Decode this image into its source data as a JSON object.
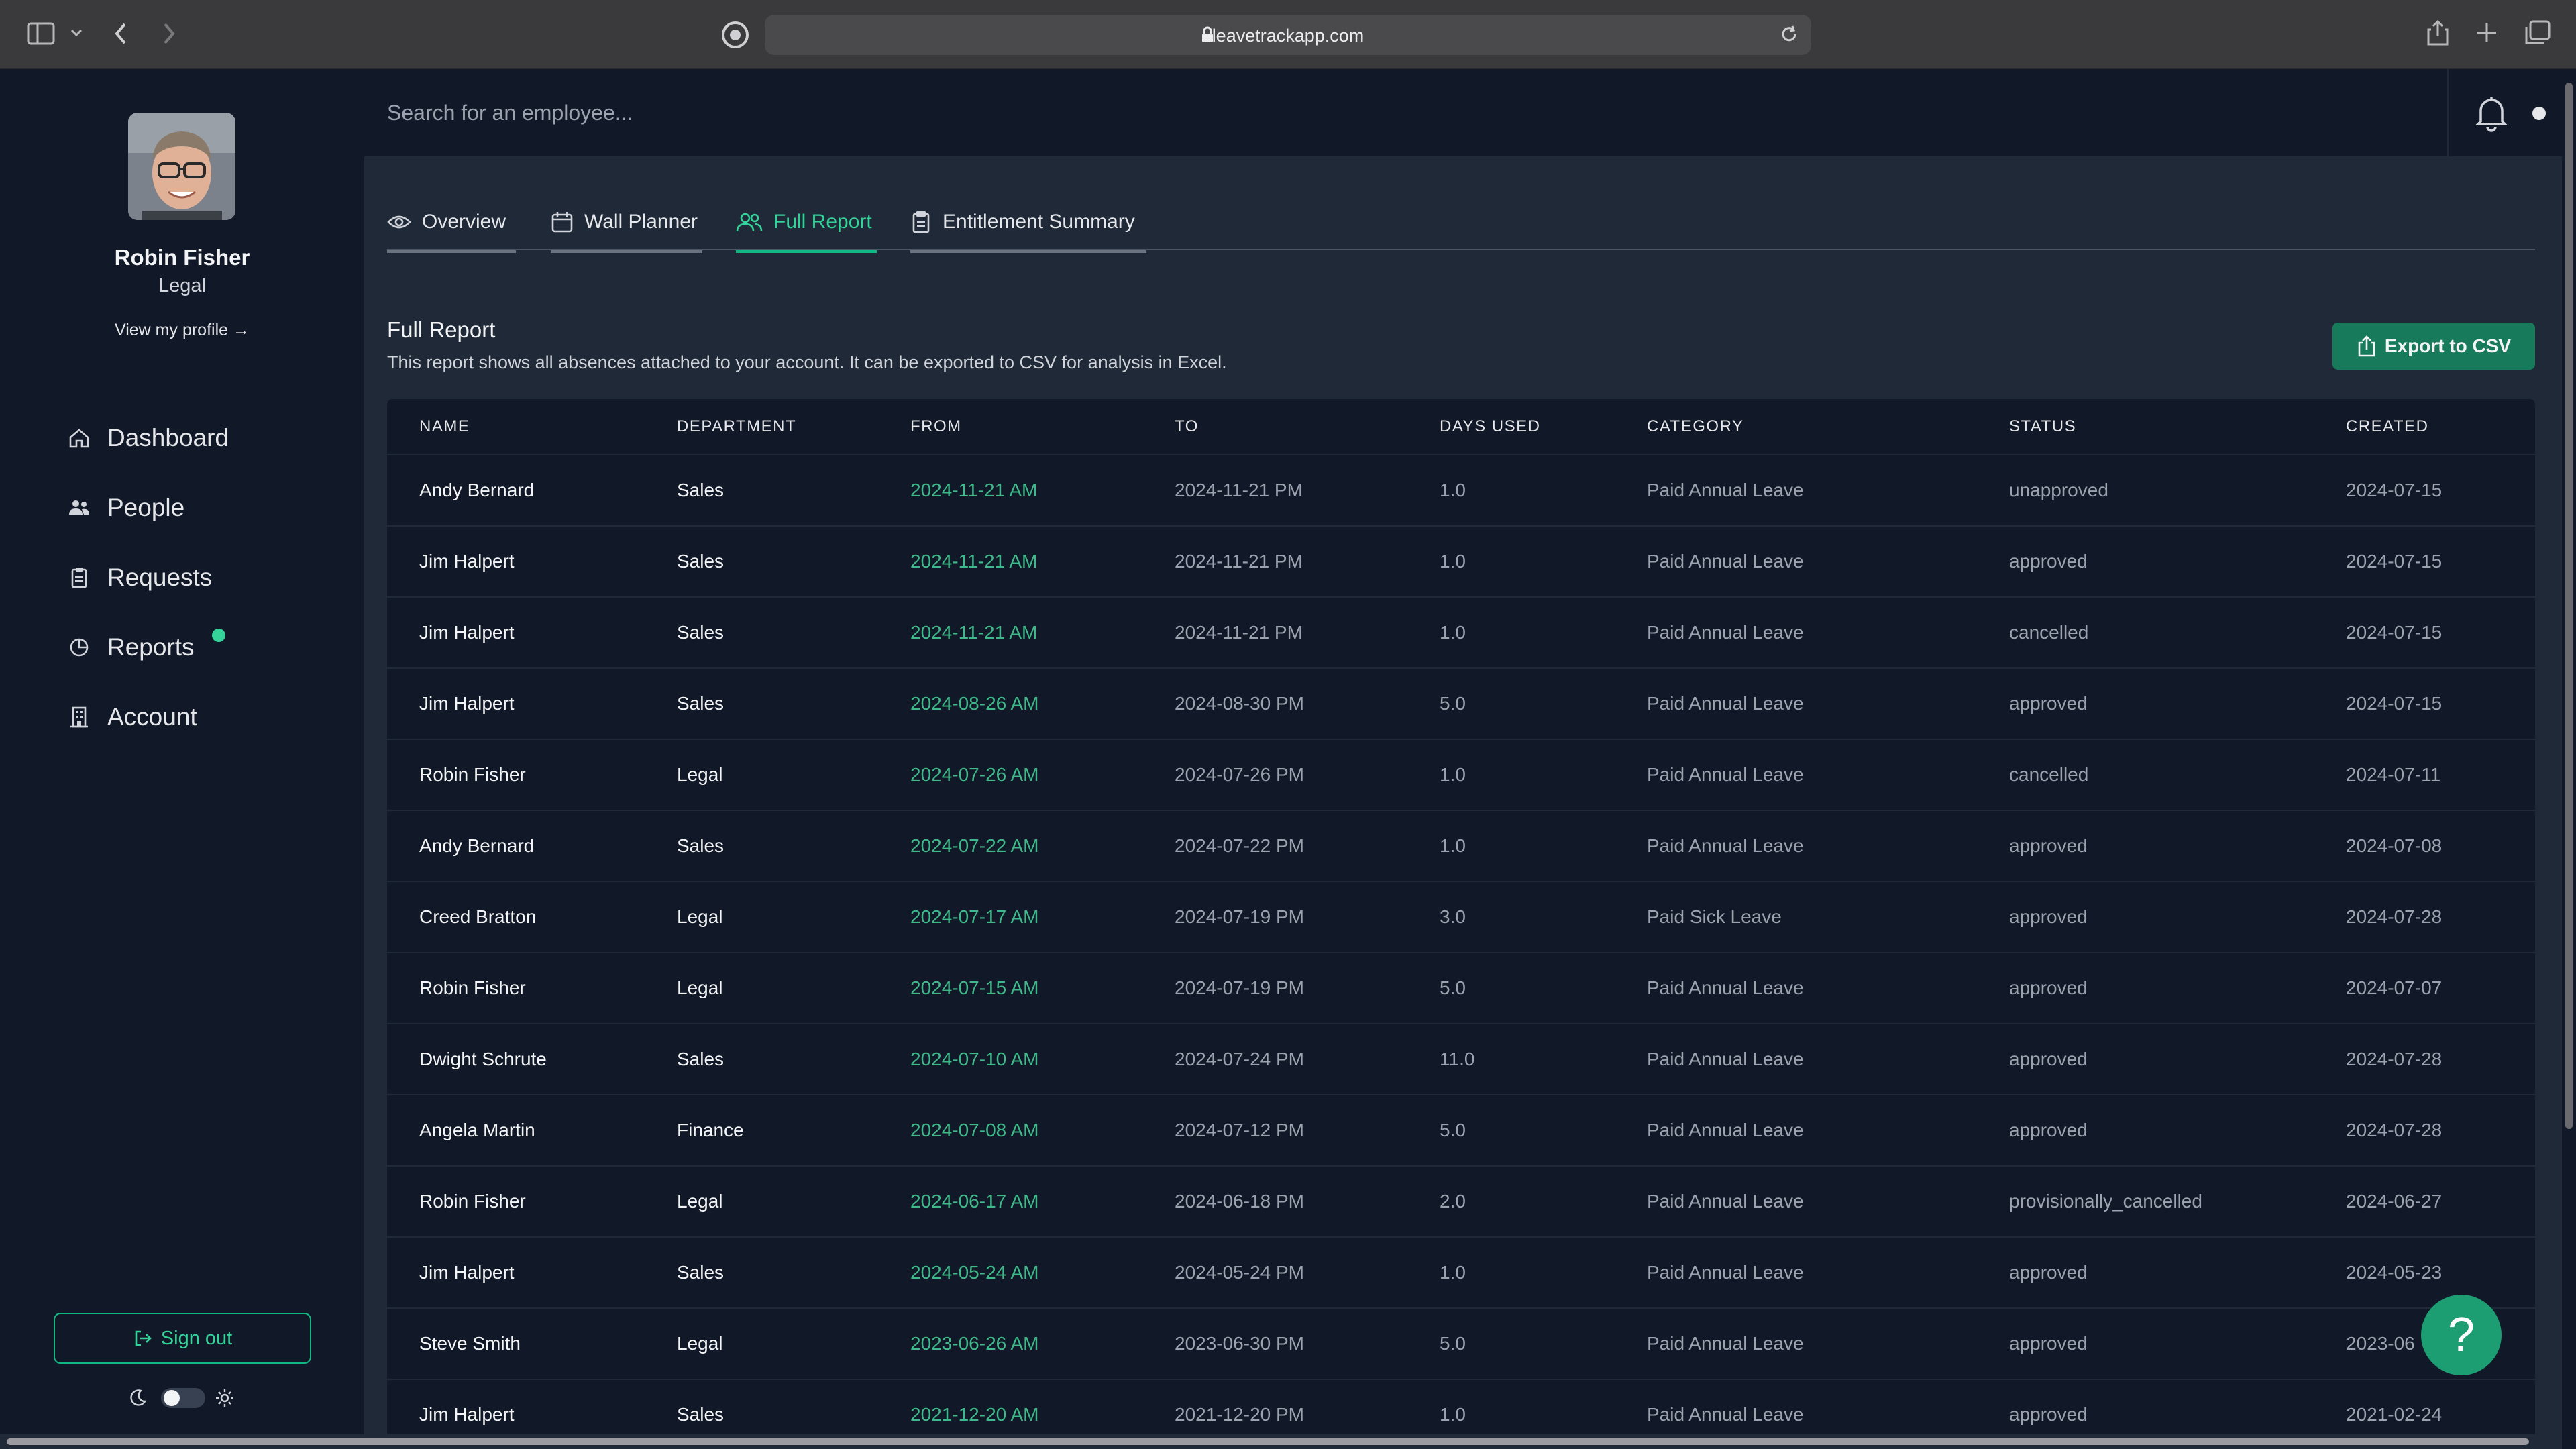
{
  "browser": {
    "url": "leavetrackapp.com"
  },
  "sidebar": {
    "user_name": "Robin Fisher",
    "user_dept": "Legal",
    "profile_link": "View my profile →",
    "nav": [
      {
        "label": "Dashboard",
        "icon": "home-icon"
      },
      {
        "label": "People",
        "icon": "people-icon"
      },
      {
        "label": "Requests",
        "icon": "clipboard-icon"
      },
      {
        "label": "Reports",
        "icon": "pie-chart-icon"
      },
      {
        "label": "Account",
        "icon": "building-icon"
      }
    ],
    "sign_out": "Sign out"
  },
  "search": {
    "placeholder": "Search for an employee..."
  },
  "tabs": [
    {
      "label": "Overview",
      "icon": "eye-icon"
    },
    {
      "label": "Wall Planner",
      "icon": "calendar-icon"
    },
    {
      "label": "Full Report",
      "icon": "users-icon",
      "active": true
    },
    {
      "label": "Entitlement Summary",
      "icon": "clipboard-icon"
    }
  ],
  "report": {
    "title": "Full Report",
    "description": "This report shows all absences attached to your account. It can be exported to CSV for analysis in Excel.",
    "export_label": "Export to CSV",
    "columns": [
      "NAME",
      "DEPARTMENT",
      "FROM",
      "TO",
      "DAYS USED",
      "CATEGORY",
      "STATUS",
      "CREATED"
    ],
    "rows": [
      [
        "Andy Bernard",
        "Sales",
        "2024-11-21 AM",
        "2024-11-21 PM",
        "1.0",
        "Paid Annual Leave",
        "unapproved",
        "2024-07-15"
      ],
      [
        "Jim Halpert",
        "Sales",
        "2024-11-21 AM",
        "2024-11-21 PM",
        "1.0",
        "Paid Annual Leave",
        "approved",
        "2024-07-15"
      ],
      [
        "Jim Halpert",
        "Sales",
        "2024-11-21 AM",
        "2024-11-21 PM",
        "1.0",
        "Paid Annual Leave",
        "cancelled",
        "2024-07-15"
      ],
      [
        "Jim Halpert",
        "Sales",
        "2024-08-26 AM",
        "2024-08-30 PM",
        "5.0",
        "Paid Annual Leave",
        "approved",
        "2024-07-15"
      ],
      [
        "Robin Fisher",
        "Legal",
        "2024-07-26 AM",
        "2024-07-26 PM",
        "1.0",
        "Paid Annual Leave",
        "cancelled",
        "2024-07-11"
      ],
      [
        "Andy Bernard",
        "Sales",
        "2024-07-22 AM",
        "2024-07-22 PM",
        "1.0",
        "Paid Annual Leave",
        "approved",
        "2024-07-08"
      ],
      [
        "Creed Bratton",
        "Legal",
        "2024-07-17 AM",
        "2024-07-19 PM",
        "3.0",
        "Paid Sick Leave",
        "approved",
        "2024-07-28"
      ],
      [
        "Robin Fisher",
        "Legal",
        "2024-07-15 AM",
        "2024-07-19 PM",
        "5.0",
        "Paid Annual Leave",
        "approved",
        "2024-07-07"
      ],
      [
        "Dwight Schrute",
        "Sales",
        "2024-07-10 AM",
        "2024-07-24 PM",
        "11.0",
        "Paid Annual Leave",
        "approved",
        "2024-07-28"
      ],
      [
        "Angela Martin",
        "Finance",
        "2024-07-08 AM",
        "2024-07-12 PM",
        "5.0",
        "Paid Annual Leave",
        "approved",
        "2024-07-28"
      ],
      [
        "Robin Fisher",
        "Legal",
        "2024-06-17 AM",
        "2024-06-18 PM",
        "2.0",
        "Paid Annual Leave",
        "provisionally_cancelled",
        "2024-06-27"
      ],
      [
        "Jim Halpert",
        "Sales",
        "2024-05-24 AM",
        "2024-05-24 PM",
        "1.0",
        "Paid Annual Leave",
        "approved",
        "2024-05-23"
      ],
      [
        "Steve Smith",
        "Legal",
        "2023-06-26 AM",
        "2023-06-30 PM",
        "5.0",
        "Paid Annual Leave",
        "approved",
        "2023-06"
      ],
      [
        "Jim Halpert",
        "Sales",
        "2021-12-20 AM",
        "2021-12-20 PM",
        "1.0",
        "Paid Annual Leave",
        "approved",
        "2021-02-24"
      ]
    ]
  },
  "help": {
    "label": "?"
  },
  "colors": {
    "accent": "#10b981",
    "background": "#1f2937",
    "panel": "#111827"
  }
}
